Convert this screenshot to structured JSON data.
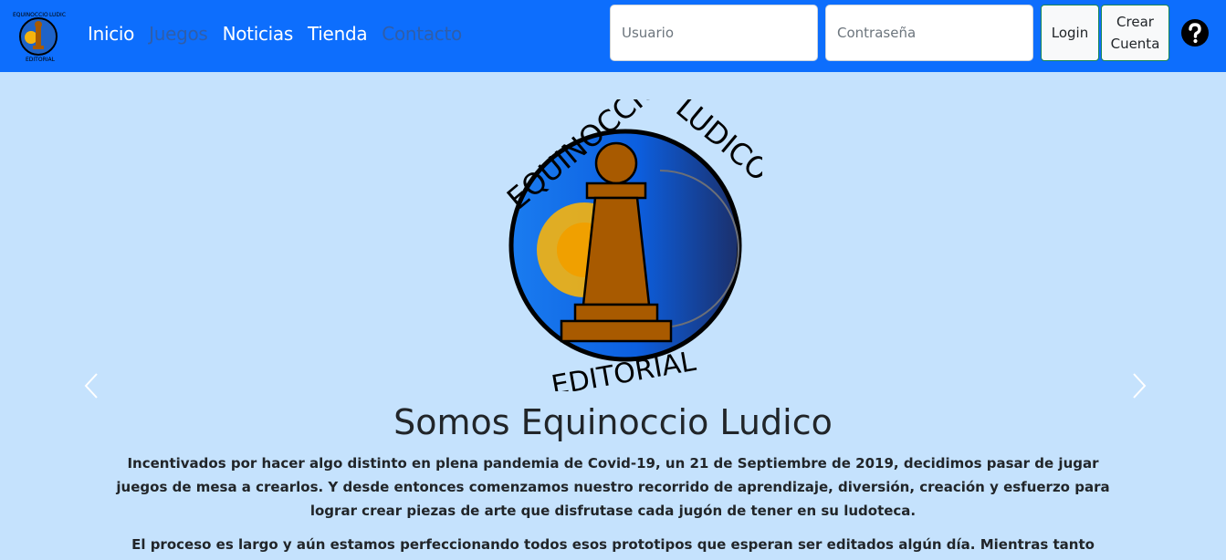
{
  "brand": {
    "logo_icon": "equinoccio-ludico-logo",
    "logo_text_top_left": "EQUINOCCIO",
    "logo_text_top_right": "LUDICO",
    "logo_text_bottom": "EDITORIAL"
  },
  "nav": {
    "items": [
      {
        "label": "Inicio",
        "muted": false
      },
      {
        "label": "Juegos",
        "muted": true
      },
      {
        "label": "Noticias",
        "muted": false
      },
      {
        "label": "Tienda",
        "muted": false
      },
      {
        "label": "Contacto",
        "muted": true
      }
    ]
  },
  "login": {
    "username_placeholder": "Usuario",
    "password_placeholder": "Contraseña",
    "login_label": "Login",
    "register_label": "Crear Cuenta",
    "help_icon": "question-circle-icon"
  },
  "hero": {
    "title": "Somos Equinoccio Ludico",
    "paragraph_1": "Incentivados por hacer algo distinto en plena pandemia de Covid-19, un 21 de Septiembre de 2019, decidimos pasar de jugar juegos de mesa a crearlos. Y desde entonces comenzamos nuestro recorrido de aprendizaje, diversión, creación y esfuerzo para lograr crear piezas de arte que disfrutase cada jugón de tener en su ludoteca.",
    "paragraph_2": "El proceso es largo y aún estamos perfeccionando todos esos prototipos que esperan ser editados algún día. Mientras tanto creamos esta web para"
  },
  "colors": {
    "navbar": "#0d6efd",
    "background": "#c5e2fd",
    "text": "#212529",
    "pawn": "#a85a00"
  }
}
